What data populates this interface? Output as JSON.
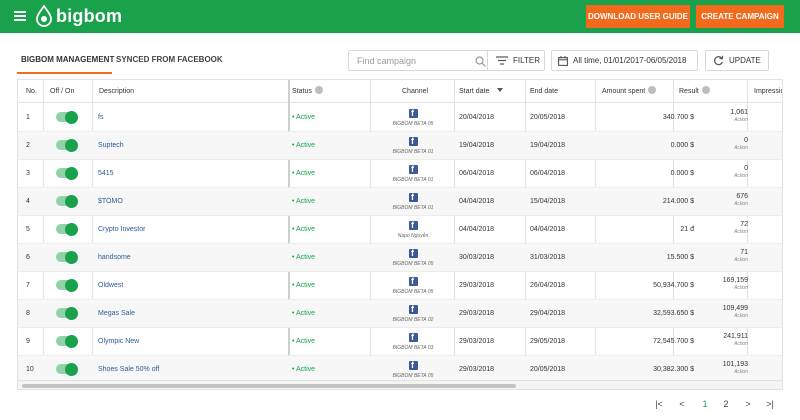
{
  "header": {
    "logo_text": "bigbom",
    "download_guide_label": "DOWNLOAD USER GUIDE",
    "create_campaign_label": "CREATE CAMPAIGN",
    "bar_color": "#1aa14b",
    "accent_color": "#f26a1b"
  },
  "tabs": [
    {
      "label": "BIGBOM MANAGEMENT",
      "active": true
    },
    {
      "label": "SYNCED FROM FACEBOOK",
      "active": false
    }
  ],
  "toolbar": {
    "search_placeholder": "Find campaign",
    "filter_label": "FILTER",
    "date_range_label": "All time, 01/01/2017-06/05/2018",
    "update_label": "UPDATE"
  },
  "table": {
    "columns": {
      "no": "No.",
      "toggle": "Off / On",
      "description": "Description",
      "status": "Status",
      "channel": "Channel",
      "start_date": "Start date",
      "end_date": "End date",
      "amount_spent": "Amount spent",
      "result": "Result",
      "impressions": "Impressio"
    },
    "rows": [
      {
        "no": "1",
        "description": "fs",
        "status": "• Active",
        "channel": "BIGBOM BETA 05",
        "start": "20/04/2018",
        "end": "20/05/2018",
        "amount": "340.700 $",
        "result": "1,061",
        "result_label": "Action",
        "on": true
      },
      {
        "no": "2",
        "description": "Suptech",
        "status": "• Active",
        "channel": "BIGBOM BETA 01",
        "start": "19/04/2018",
        "end": "19/04/2018",
        "amount": "0.000 $",
        "result": "0",
        "result_label": "Action",
        "on": true
      },
      {
        "no": "3",
        "description": "5415",
        "status": "• Active",
        "channel": "BIGBOM BETA 01",
        "start": "06/04/2018",
        "end": "06/04/2018",
        "amount": "0.000 $",
        "result": "0",
        "result_label": "Action",
        "on": true
      },
      {
        "no": "4",
        "description": "$TOMO",
        "status": "• Active",
        "channel": "BIGBOM BETA 01",
        "start": "04/04/2018",
        "end": "15/04/2018",
        "amount": "214.000 $",
        "result": "676",
        "result_label": "Action",
        "on": true
      },
      {
        "no": "5",
        "description": "Crypto Investor",
        "status": "• Active",
        "channel": "Napo Nguyễn",
        "start": "04/04/2018",
        "end": "04/04/2018",
        "amount": "21 đ",
        "result": "72",
        "result_label": "Action",
        "on": true
      },
      {
        "no": "6",
        "description": "handsome",
        "status": "• Active",
        "channel": "BIGBOM BETA 05",
        "start": "30/03/2018",
        "end": "31/03/2018",
        "amount": "15.500 $",
        "result": "71",
        "result_label": "Action",
        "on": true
      },
      {
        "no": "7",
        "description": "Oldwest",
        "status": "• Active",
        "channel": "BIGBOM BETA 05",
        "start": "29/03/2018",
        "end": "26/04/2018",
        "amount": "50,934.700 $",
        "result": "169,159",
        "result_label": "Action",
        "on": true
      },
      {
        "no": "8",
        "description": "Megas Sale",
        "status": "• Active",
        "channel": "BIGBOM BETA 02",
        "start": "29/03/2018",
        "end": "29/04/2018",
        "amount": "32,593.650 $",
        "result": "109,499",
        "result_label": "Action",
        "on": true
      },
      {
        "no": "9",
        "description": "Olympic New",
        "status": "• Active",
        "channel": "BIGBOM BETA 03",
        "start": "29/03/2018",
        "end": "29/05/2018",
        "amount": "72,545.700 $",
        "result": "241,911",
        "result_label": "Action",
        "on": true
      },
      {
        "no": "10",
        "description": "Shoes Sale 50% off",
        "status": "• Active",
        "channel": "BIGBOM BETA 05",
        "start": "29/03/2018",
        "end": "20/05/2018",
        "amount": "30,382.300 $",
        "result": "101,193",
        "result_label": "Action",
        "on": true
      }
    ]
  },
  "pagination": {
    "first": "|<",
    "prev": "<",
    "pages": [
      "1",
      "2"
    ],
    "active_page": "1",
    "next": ">",
    "last": ">|"
  }
}
